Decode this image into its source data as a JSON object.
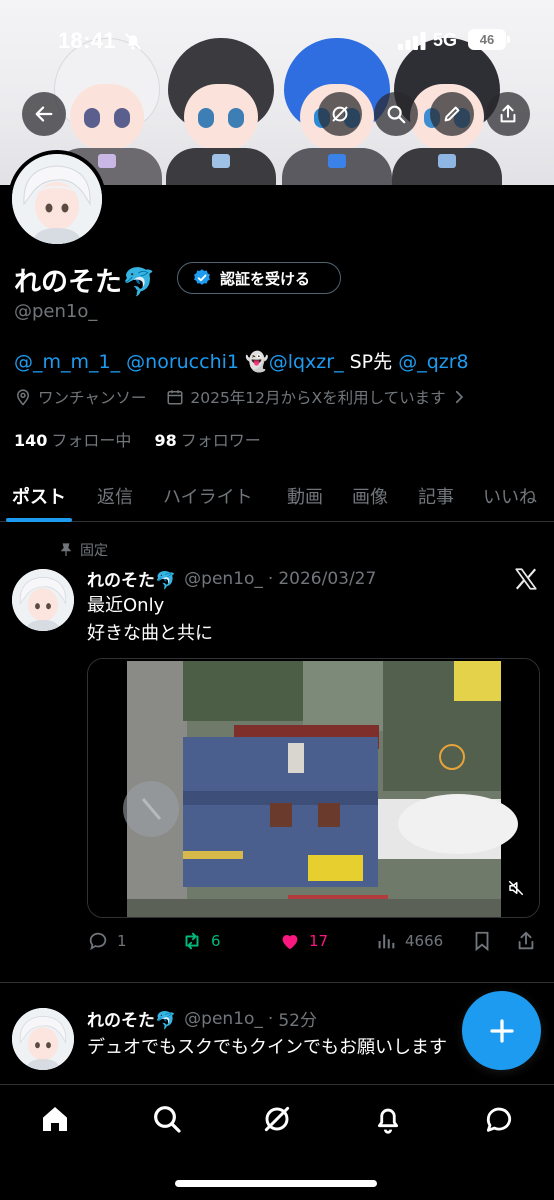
{
  "status_bar": {
    "time": "18:41",
    "network": "5G",
    "battery": "46"
  },
  "profile": {
    "display_name": "れのそた🐬",
    "verify_label": "認証を受ける",
    "handle": "@pen1o_",
    "bio": {
      "mention1": "@_m_m_1_",
      "mention2": "@norucchi1",
      "ghost": "👻",
      "mention3": "@lqxzr_",
      "text": "SP先",
      "mention4": "@_qzr8"
    },
    "location": "ワンチャンソー",
    "joined": "2025年12月からXを利用しています",
    "following_count": "140",
    "following_label": "フォロー中",
    "followers_count": "98",
    "followers_label": "フォロワー"
  },
  "tabs": [
    "ポスト",
    "返信",
    "ハイライト",
    "動画",
    "画像",
    "記事",
    "いいね"
  ],
  "pinned_label": "固定",
  "posts": [
    {
      "name": "れのそた🐬",
      "handle": "@pen1o_",
      "sep": "·",
      "time": "2026/03/27",
      "lines": [
        "最近Only",
        "好きな曲と共に"
      ],
      "replies": "1",
      "reposts": "6",
      "likes": "17",
      "views": "4666"
    },
    {
      "name": "れのそた🐬",
      "handle": "@pen1o_",
      "sep": "·",
      "time": "52分",
      "lines": [
        "デュオでもスクでもクインでもお願いします"
      ]
    }
  ],
  "icons": {
    "back": "back-arrow-icon",
    "grok": "grok-icon",
    "search": "search-icon",
    "edit": "edit-pencil-icon",
    "share": "share-icon",
    "compose": "plus-icon"
  },
  "colors": {
    "accent": "#1d9bf0",
    "retweet": "#00ba7c",
    "like": "#f91880",
    "muted": "#71767b"
  }
}
